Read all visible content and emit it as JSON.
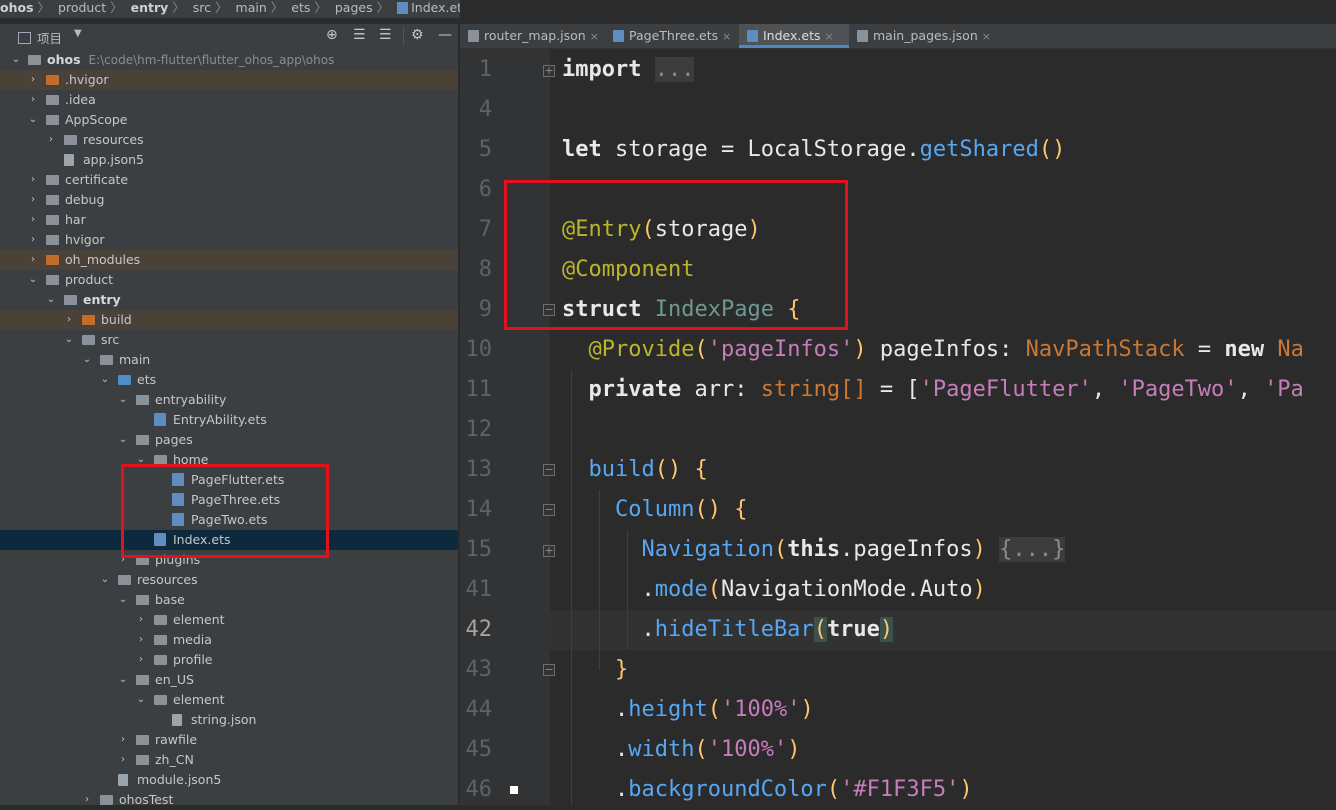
{
  "breadcrumb": [
    "ohos",
    "product",
    "entry",
    "src",
    "main",
    "ets",
    "pages",
    "Index.ets"
  ],
  "project_panel": {
    "title": "项目",
    "root_name": "ohos",
    "root_path": "E:\\code\\hm-flutter\\flutter_ohos_app\\ohos",
    "toolbar_icons": [
      "locate-icon",
      "expand-all-icon",
      "collapse-all-icon",
      "gear-icon",
      "minimize-icon"
    ]
  },
  "tree": [
    {
      "label": ".hvigor",
      "chev": "›",
      "icon": "folder-orange",
      "state": "excluded"
    },
    {
      "label": ".idea",
      "chev": "›",
      "icon": "folder"
    },
    {
      "label": "AppScope",
      "chev": "⌄",
      "icon": "folder"
    },
    {
      "label": "resources",
      "chev": "›",
      "icon": "folder"
    },
    {
      "label": "app.json5",
      "chev": "",
      "icon": "file"
    },
    {
      "label": "certificate",
      "chev": "›",
      "icon": "folder"
    },
    {
      "label": "debug",
      "chev": "›",
      "icon": "folder"
    },
    {
      "label": "har",
      "chev": "›",
      "icon": "folder"
    },
    {
      "label": "hvigor",
      "chev": "›",
      "icon": "folder"
    },
    {
      "label": "oh_modules",
      "chev": "›",
      "icon": "folder-orange",
      "state": "excluded"
    },
    {
      "label": "product",
      "chev": "⌄",
      "icon": "folder"
    },
    {
      "label": "entry",
      "chev": "⌄",
      "icon": "folder",
      "bold": true
    },
    {
      "label": "build",
      "chev": "›",
      "icon": "folder-orange",
      "state": "excluded"
    },
    {
      "label": "src",
      "chev": "⌄",
      "icon": "folder"
    },
    {
      "label": "main",
      "chev": "⌄",
      "icon": "folder"
    },
    {
      "label": "ets",
      "chev": "⌄",
      "icon": "folder-blue"
    },
    {
      "label": "entryability",
      "chev": "⌄",
      "icon": "folder"
    },
    {
      "label": "EntryAbility.ets",
      "chev": "",
      "icon": "file-ets"
    },
    {
      "label": "pages",
      "chev": "⌄",
      "icon": "folder"
    },
    {
      "label": "home",
      "chev": "⌄",
      "icon": "folder"
    },
    {
      "label": "PageFlutter.ets",
      "chev": "",
      "icon": "file-ets"
    },
    {
      "label": "PageThree.ets",
      "chev": "",
      "icon": "file-ets"
    },
    {
      "label": "PageTwo.ets",
      "chev": "",
      "icon": "file-ets"
    },
    {
      "label": "Index.ets",
      "chev": "",
      "icon": "file-ets",
      "state": "selected"
    },
    {
      "label": "plugins",
      "chev": "›",
      "icon": "folder"
    },
    {
      "label": "resources",
      "chev": "⌄",
      "icon": "folder"
    },
    {
      "label": "base",
      "chev": "⌄",
      "icon": "folder"
    },
    {
      "label": "element",
      "chev": "›",
      "icon": "folder"
    },
    {
      "label": "media",
      "chev": "›",
      "icon": "folder"
    },
    {
      "label": "profile",
      "chev": "›",
      "icon": "folder"
    },
    {
      "label": "en_US",
      "chev": "⌄",
      "icon": "folder"
    },
    {
      "label": "element",
      "chev": "⌄",
      "icon": "folder"
    },
    {
      "label": "string.json",
      "chev": "",
      "icon": "file"
    },
    {
      "label": "rawfile",
      "chev": "›",
      "icon": "folder"
    },
    {
      "label": "zh_CN",
      "chev": "›",
      "icon": "folder"
    },
    {
      "label": "module.json5",
      "chev": "",
      "icon": "file"
    },
    {
      "label": "ohosTest",
      "chev": "›",
      "icon": "folder"
    }
  ],
  "tabs": [
    {
      "label": "router_map.json",
      "close": "×"
    },
    {
      "label": "PageThree.ets",
      "close": "×"
    },
    {
      "label": "Index.ets",
      "close": "×",
      "active": true
    },
    {
      "label": "main_pages.json",
      "close": "×"
    }
  ],
  "line_numbers": [
    "1",
    "4",
    "5",
    "6",
    "7",
    "8",
    "9",
    "10",
    "11",
    "12",
    "13",
    "14",
    "15",
    "41",
    "42",
    "43",
    "44",
    "45",
    "46"
  ],
  "current_line": "42",
  "code": {
    "l1_kw": "import",
    "l1_fold": "...",
    "l5_let": "let",
    "l5_rest": " storage = LocalStorage.",
    "l5_fn": "getShared",
    "l5_paren": "()",
    "l7_ann": "@Entry",
    "l7_open": "(",
    "l7_arg": "storage",
    "l7_close": ")",
    "l8_ann": "@Component",
    "l9_kw": "struct",
    "l9_name": "IndexPage",
    "l9_brace": "{",
    "l10_ann": "@Provide",
    "l10_open": "(",
    "l10_str": "'pageInfos'",
    "l10_close": ")",
    "l10_prop": " pageInfos: ",
    "l10_type": "NavPathStack",
    "l10_eq": " = ",
    "l10_new": "new",
    "l10_rest": " Na",
    "l11_kw": "private",
    "l11_prop": " arr: ",
    "l11_type": "string[]",
    "l11_eq": " = [",
    "l11_s1": "'PageFlutter'",
    "l11_c1": ", ",
    "l11_s2": "'PageTwo'",
    "l11_c2": ", ",
    "l11_s3": "'Pa",
    "l13_fn": "build",
    "l13_paren": "()",
    "l13_brace": "{",
    "l14_fn": "Column",
    "l14_paren": "()",
    "l14_brace": "{",
    "l15_fn": "Navigation",
    "l15_open": "(",
    "l15_this": "this",
    "l15_arg": ".pageInfos",
    "l15_close": ")",
    "l15_fold": "{...}",
    "l41_dot": ".",
    "l41_fn": "mode",
    "l41_open": "(",
    "l41_arg": "NavigationMode.Auto",
    "l41_close": ")",
    "l42_dot": ".",
    "l42_fn": "hideTitleBar",
    "l42_open": "(",
    "l42_arg": "true",
    "l42_close": ")",
    "l43_brace": "}",
    "l44_dot": ".",
    "l44_fn": "height",
    "l44_open": "(",
    "l44_str": "'100%'",
    "l44_close": ")",
    "l45_dot": ".",
    "l45_fn": "width",
    "l45_open": "(",
    "l45_str": "'100%'",
    "l45_close": ")",
    "l46_dot": ".",
    "l46_fn": "backgroundColor",
    "l46_open": "(",
    "l46_str": "'#F1F3F5'",
    "l46_close": ")"
  }
}
